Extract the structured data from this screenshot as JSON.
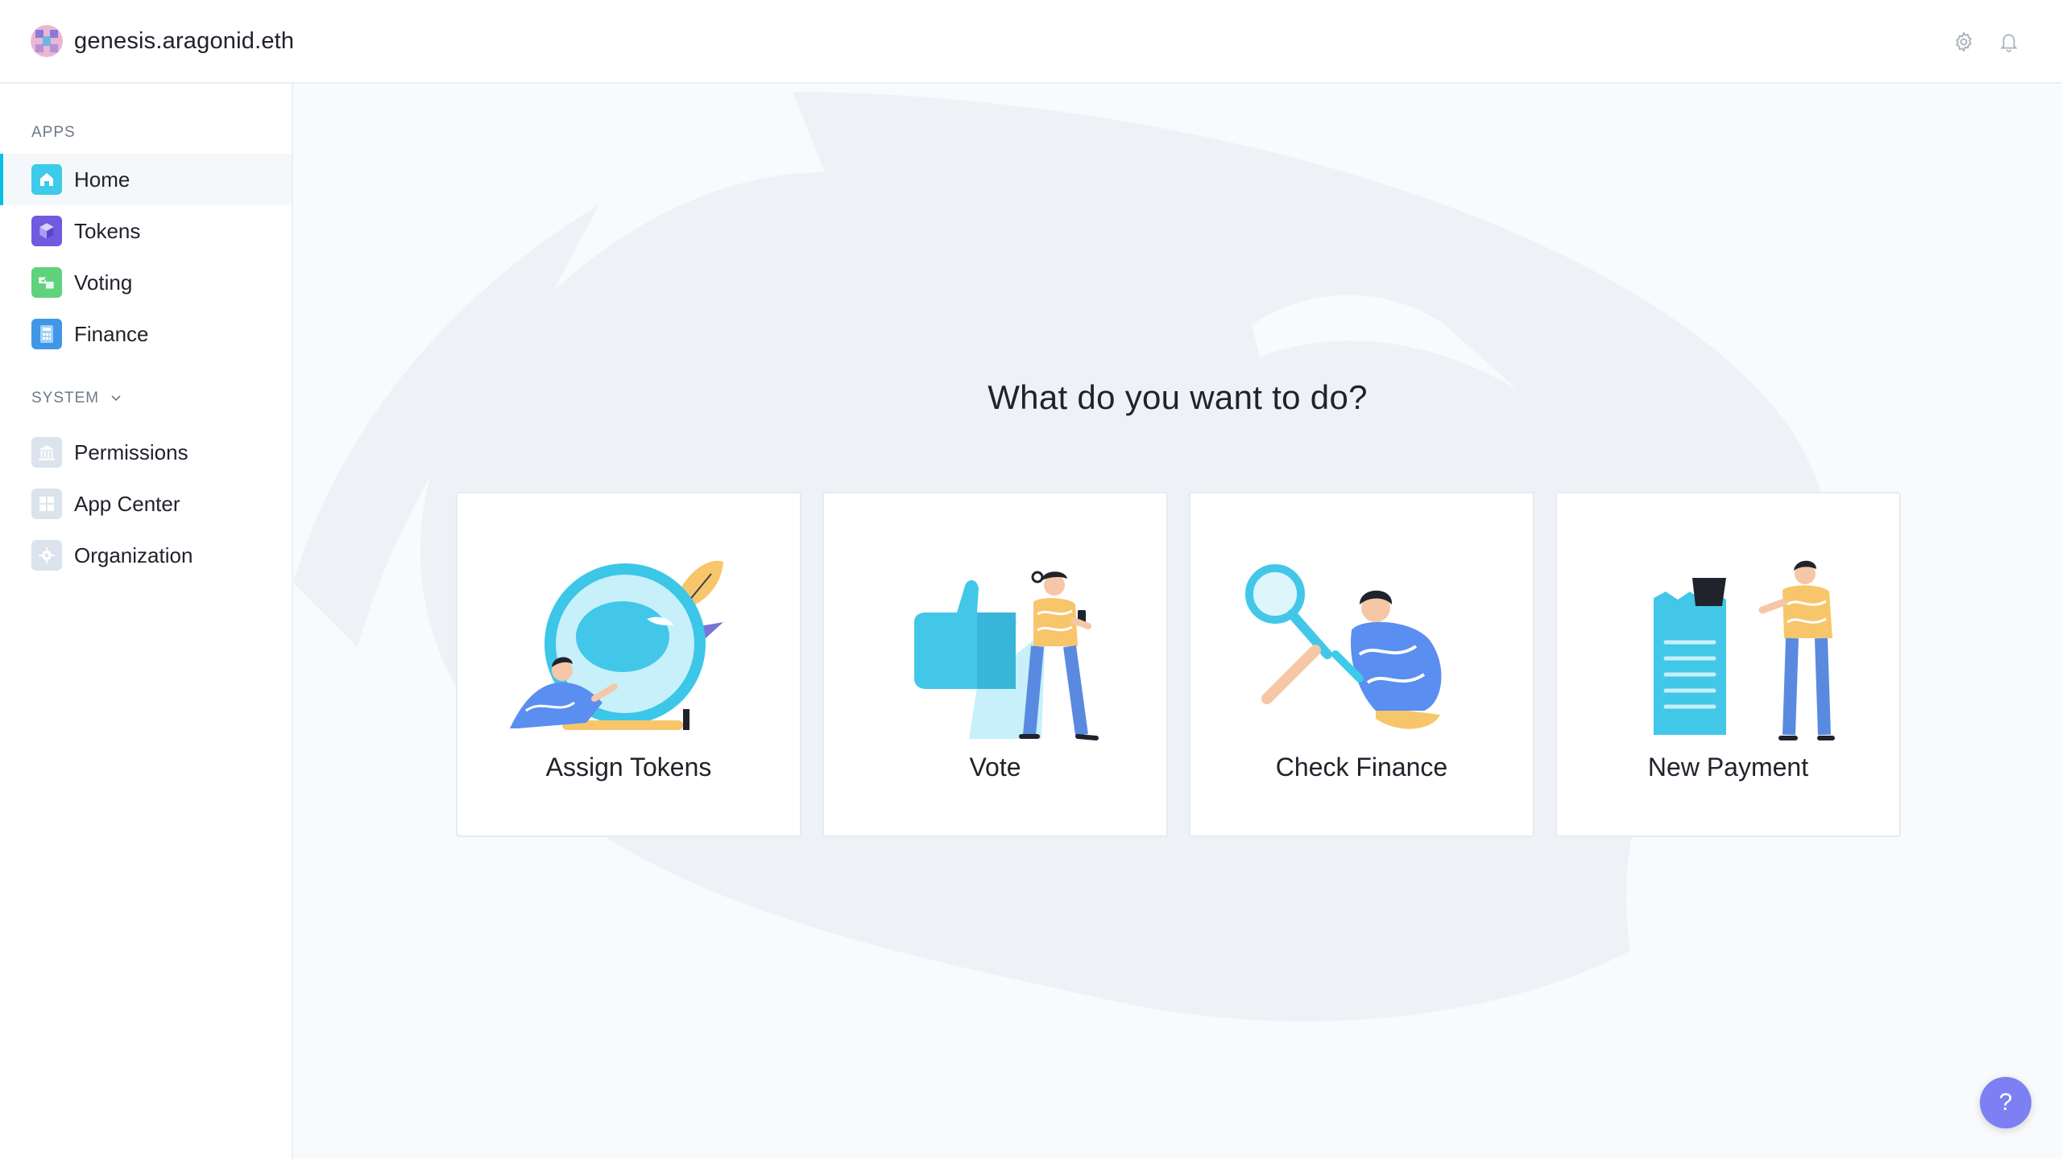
{
  "header": {
    "org_name": "genesis.aragonid.eth",
    "settings_icon": "gear-icon",
    "notifications_icon": "bell-icon"
  },
  "sidebar": {
    "apps_label": "APPS",
    "apps": [
      {
        "label": "Home",
        "icon": "home-icon",
        "color": "#3ccbe8",
        "active": true
      },
      {
        "label": "Tokens",
        "icon": "tokens-icon",
        "color": "#6f5ae0",
        "active": false
      },
      {
        "label": "Voting",
        "icon": "voting-icon",
        "color": "#5fd27c",
        "active": false
      },
      {
        "label": "Finance",
        "icon": "finance-icon",
        "color": "#3f97e6",
        "active": false
      }
    ],
    "system_label": "SYSTEM",
    "system": [
      {
        "label": "Permissions",
        "icon": "permissions-icon"
      },
      {
        "label": "App Center",
        "icon": "app-center-icon"
      },
      {
        "label": "Organization",
        "icon": "organization-icon"
      }
    ]
  },
  "main": {
    "title": "What do you want to do?",
    "actions": [
      {
        "label": "Assign Tokens",
        "icon": "assign-tokens-illustration"
      },
      {
        "label": "Vote",
        "icon": "vote-illustration"
      },
      {
        "label": "Check Finance",
        "icon": "check-finance-illustration"
      },
      {
        "label": "New Payment",
        "icon": "new-payment-illustration"
      }
    ]
  },
  "help": {
    "label": "?"
  },
  "colors": {
    "accent": "#08bee5",
    "help_button": "#7c80f2",
    "background": "#f8fafc"
  }
}
